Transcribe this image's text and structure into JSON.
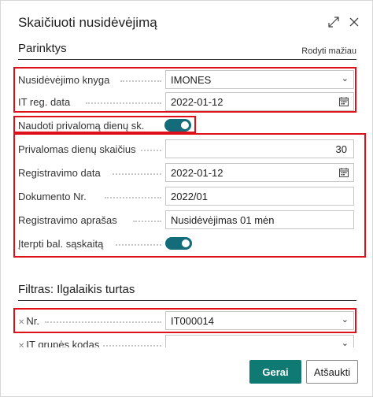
{
  "dialog": {
    "title": "Skaičiuoti nusidėvėjimą",
    "expand_icon": "expand-icon",
    "close_icon": "close-icon"
  },
  "options": {
    "title": "Parinktys",
    "show_less": "Rodyti mažiau",
    "fields": {
      "depr_book_label": "Nusidėvėjimo knyga",
      "depr_book_value": "IMONES",
      "fa_posting_date_label": "IT reg. data",
      "fa_posting_date_value": "2022-01-12",
      "use_forced_days_label": "Naudoti privalomą dienų sk.",
      "use_forced_days_on": true,
      "forced_days_label": "Privalomas dienų skaičius",
      "forced_days_value": "30",
      "posting_date_label": "Registravimo data",
      "posting_date_value": "2022-01-12",
      "document_no_label": "Dokumento Nr.",
      "document_no_value": "2022/01",
      "posting_description_label": "Registravimo aprašas",
      "posting_description_value": "Nusidėvėjimas 01 mėn",
      "insert_bal_account_label": "Įterpti bal. sąskaitą",
      "insert_bal_account_on": true
    }
  },
  "filter": {
    "title": "Filtras: Ilgalaikis turtas",
    "no_label": "Nr.",
    "no_value": "IT000014",
    "fa_group_label": "IT grupės kodas",
    "fa_group_value": ""
  },
  "buttons": {
    "ok": "Gerai",
    "cancel": "Atšaukti"
  },
  "colors": {
    "accent": "#0e7a73",
    "toggle": "#146b7a",
    "highlight": "#e0101a"
  }
}
